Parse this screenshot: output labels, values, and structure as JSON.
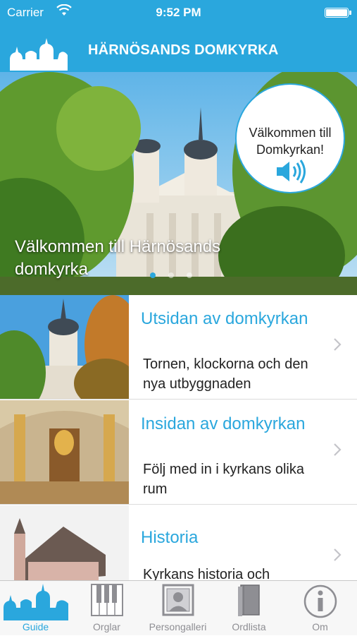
{
  "status_bar": {
    "carrier": "Carrier",
    "time": "9:52 PM"
  },
  "header": {
    "title": "HÄRNÖSANDS DOMKYRKA",
    "logo_icon": "cathedral-icon"
  },
  "hero": {
    "caption": "Välkommen till Härnösands domkyrka",
    "bubble_text": "Välkommen till Domkyrkan!",
    "bubble_icon": "speaker-icon",
    "pages": 3,
    "active_page": 1
  },
  "rows": [
    {
      "title": "Utsidan av domkyrkan",
      "subtitle": "Tornen, klockorna och den nya utbyggnaden"
    },
    {
      "title": "Insidan av domkyrkan",
      "subtitle": "Följ med in i kyrkans olika rum"
    },
    {
      "title": "Historia",
      "subtitle": "Kyrkans historia och"
    }
  ],
  "tabs": [
    {
      "label": "Guide",
      "icon": "cathedral-icon",
      "active": true
    },
    {
      "label": "Orglar",
      "icon": "piano-keys-icon",
      "active": false
    },
    {
      "label": "Persongalleri",
      "icon": "portrait-icon",
      "active": false
    },
    {
      "label": "Ordlista",
      "icon": "book-icon",
      "active": false
    },
    {
      "label": "Om",
      "icon": "info-icon",
      "active": false
    }
  ],
  "colors": {
    "accent": "#2aa7dd",
    "tab_inactive": "#8e8e93"
  }
}
